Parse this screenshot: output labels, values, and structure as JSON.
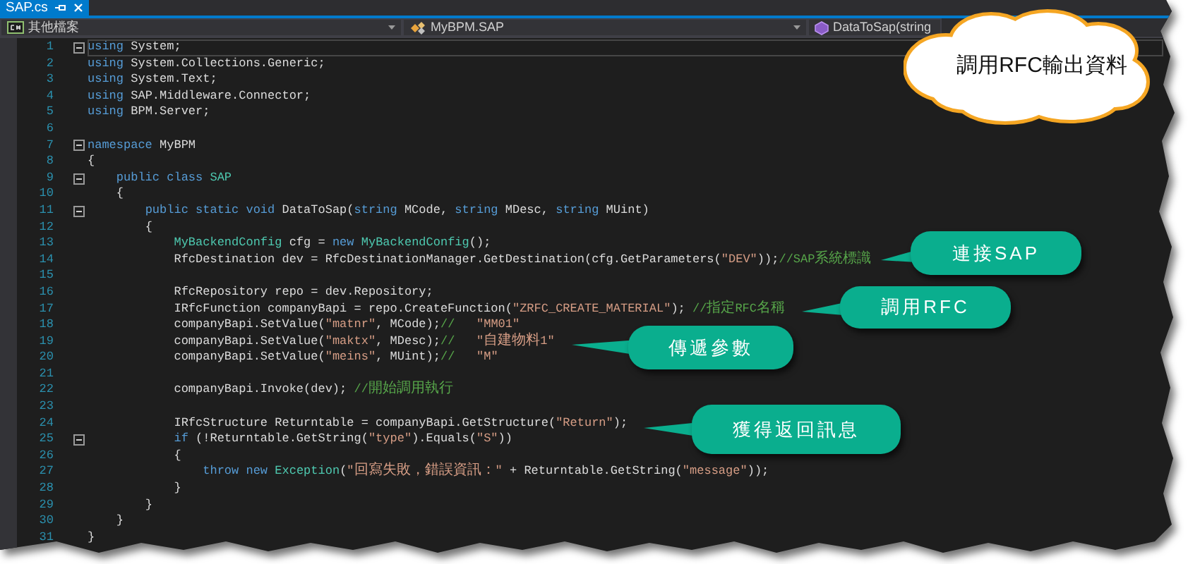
{
  "tab": {
    "label": "SAP.cs",
    "selected": true
  },
  "navigation": [
    {
      "kind": "file",
      "label": "其他檔案"
    },
    {
      "kind": "class",
      "label": "MyBPM.SAP"
    },
    {
      "kind": "method",
      "label": "DataToSap(string"
    }
  ],
  "code_lines": [
    {
      "number": "1",
      "fold": true,
      "current": true,
      "tokens": [
        {
          "kind": "keyword",
          "text": "using"
        },
        {
          "kind": "plain",
          "text": " System;"
        }
      ]
    },
    {
      "number": "2",
      "fold": false,
      "current": false,
      "tokens": [
        {
          "kind": "keyword",
          "text": "using"
        },
        {
          "kind": "plain",
          "text": " System.Collections.Generic;"
        }
      ]
    },
    {
      "number": "3",
      "fold": false,
      "current": false,
      "tokens": [
        {
          "kind": "keyword",
          "text": "using"
        },
        {
          "kind": "plain",
          "text": " System.Text;"
        }
      ]
    },
    {
      "number": "4",
      "fold": false,
      "current": false,
      "tokens": [
        {
          "kind": "keyword",
          "text": "using"
        },
        {
          "kind": "plain",
          "text": " SAP.Middleware.Connector;"
        }
      ]
    },
    {
      "number": "5",
      "fold": false,
      "current": false,
      "tokens": [
        {
          "kind": "keyword",
          "text": "using"
        },
        {
          "kind": "plain",
          "text": " BPM.Server;"
        }
      ]
    },
    {
      "number": "6",
      "fold": false,
      "current": false
    },
    {
      "number": "7",
      "fold": true,
      "current": false,
      "tokens": [
        {
          "kind": "keyword",
          "text": "namespace"
        },
        {
          "kind": "plain",
          "text": " MyBPM"
        }
      ]
    },
    {
      "number": "8",
      "fold": false,
      "current": false,
      "tokens": [
        {
          "kind": "plain",
          "text": "{"
        }
      ]
    },
    {
      "number": "9",
      "fold": true,
      "current": false,
      "tokens": [
        {
          "kind": "keyword",
          "text": "    public class"
        },
        {
          "kind": "type",
          "text": " SAP"
        }
      ]
    },
    {
      "number": "10",
      "fold": false,
      "current": false,
      "tokens": [
        {
          "kind": "plain",
          "text": "    {"
        }
      ]
    },
    {
      "number": "11",
      "fold": true,
      "current": false,
      "tokens": [
        {
          "kind": "keyword",
          "text": "        public static void"
        },
        {
          "kind": "plain",
          "text": " DataToSap("
        },
        {
          "kind": "keyword",
          "text": "string"
        },
        {
          "kind": "plain",
          "text": " MCode, "
        },
        {
          "kind": "keyword",
          "text": "string"
        },
        {
          "kind": "plain",
          "text": " MDesc, "
        },
        {
          "kind": "keyword",
          "text": "string"
        },
        {
          "kind": "plain",
          "text": " MUint)"
        }
      ]
    },
    {
      "number": "12",
      "fold": false,
      "current": false,
      "tokens": [
        {
          "kind": "plain",
          "text": "        {"
        }
      ]
    },
    {
      "number": "13",
      "fold": false,
      "current": false,
      "tokens": [
        {
          "kind": "type",
          "text": "            MyBackendConfig"
        },
        {
          "kind": "plain",
          "text": " cfg = "
        },
        {
          "kind": "keyword",
          "text": "new"
        },
        {
          "kind": "type",
          "text": " MyBackendConfig"
        },
        {
          "kind": "plain",
          "text": "();"
        }
      ]
    },
    {
      "number": "14",
      "fold": false,
      "current": false,
      "tokens": [
        {
          "kind": "plain",
          "text": "            RfcDestination dev = RfcDestinationManager.GetDestination(cfg.GetParameters("
        },
        {
          "kind": "string",
          "text": "\"DEV\""
        },
        {
          "kind": "plain",
          "text": "));"
        },
        {
          "kind": "comment",
          "text": "//SAP系統標識"
        }
      ]
    },
    {
      "number": "15",
      "fold": false,
      "current": false
    },
    {
      "number": "16",
      "fold": false,
      "current": false,
      "tokens": [
        {
          "kind": "plain",
          "text": "            RfcRepository repo = dev.Repository;"
        }
      ]
    },
    {
      "number": "17",
      "fold": false,
      "current": false,
      "tokens": [
        {
          "kind": "plain",
          "text": "            IRfcFunction companyBapi = repo.CreateFunction("
        },
        {
          "kind": "string",
          "text": "\"ZRFC_CREATE_MATERIAL\""
        },
        {
          "kind": "plain",
          "text": "); "
        },
        {
          "kind": "comment",
          "text": "//指定RFC名稱"
        }
      ]
    },
    {
      "number": "18",
      "fold": false,
      "current": false,
      "tokens": [
        {
          "kind": "plain",
          "text": "            companyBapi.SetValue("
        },
        {
          "kind": "string",
          "text": "\"matnr\""
        },
        {
          "kind": "plain",
          "text": ", MCode);"
        },
        {
          "kind": "comment",
          "text": "//"
        },
        {
          "kind": "string",
          "text": "   \"MM01\""
        }
      ]
    },
    {
      "number": "19",
      "fold": false,
      "current": false,
      "tokens": [
        {
          "kind": "plain",
          "text": "            companyBapi.SetValue("
        },
        {
          "kind": "string",
          "text": "\"maktx\""
        },
        {
          "kind": "plain",
          "text": ", MDesc);"
        },
        {
          "kind": "comment",
          "text": "//"
        },
        {
          "kind": "string",
          "text": "   \"自建物料1\""
        }
      ]
    },
    {
      "number": "20",
      "fold": false,
      "current": false,
      "tokens": [
        {
          "kind": "plain",
          "text": "            companyBapi.SetValue("
        },
        {
          "kind": "string",
          "text": "\"meins\""
        },
        {
          "kind": "plain",
          "text": ", MUint);"
        },
        {
          "kind": "comment",
          "text": "//"
        },
        {
          "kind": "string",
          "text": "   \"M\""
        }
      ]
    },
    {
      "number": "21",
      "fold": false,
      "current": false
    },
    {
      "number": "22",
      "fold": false,
      "current": false,
      "tokens": [
        {
          "kind": "plain",
          "text": "            companyBapi.Invoke(dev); "
        },
        {
          "kind": "comment",
          "text": "//開始調用執行"
        }
      ]
    },
    {
      "number": "23",
      "fold": false,
      "current": false
    },
    {
      "number": "24",
      "fold": false,
      "current": false,
      "tokens": [
        {
          "kind": "plain",
          "text": "            IRfcStructure Returntable = companyBapi.GetStructure("
        },
        {
          "kind": "string",
          "text": "\"Return\""
        },
        {
          "kind": "plain",
          "text": ");"
        }
      ]
    },
    {
      "number": "25",
      "fold": true,
      "current": false,
      "tokens": [
        {
          "kind": "keyword",
          "text": "            if"
        },
        {
          "kind": "plain",
          "text": " (!Returntable.GetString("
        },
        {
          "kind": "string",
          "text": "\"type\""
        },
        {
          "kind": "plain",
          "text": ").Equals("
        },
        {
          "kind": "string",
          "text": "\"S\""
        },
        {
          "kind": "plain",
          "text": "))"
        }
      ]
    },
    {
      "number": "26",
      "fold": false,
      "current": false,
      "tokens": [
        {
          "kind": "plain",
          "text": "            {"
        }
      ]
    },
    {
      "number": "27",
      "fold": false,
      "current": false,
      "tokens": [
        {
          "kind": "keyword",
          "text": "                throw new"
        },
        {
          "kind": "type",
          "text": " Exception"
        },
        {
          "kind": "plain",
          "text": "("
        },
        {
          "kind": "string",
          "text": "\"回寫失敗，錯誤資訊：\""
        },
        {
          "kind": "plain",
          "text": " + Returntable.GetString("
        },
        {
          "kind": "string",
          "text": "\"message\""
        },
        {
          "kind": "plain",
          "text": "));"
        }
      ]
    },
    {
      "number": "28",
      "fold": false,
      "current": false,
      "tokens": [
        {
          "kind": "plain",
          "text": "            }"
        }
      ]
    },
    {
      "number": "29",
      "fold": false,
      "current": false,
      "tokens": [
        {
          "kind": "plain",
          "text": "        }"
        }
      ]
    },
    {
      "number": "30",
      "fold": false,
      "current": false,
      "tokens": [
        {
          "kind": "plain",
          "text": "    }"
        }
      ]
    },
    {
      "number": "31",
      "fold": false,
      "current": false,
      "tokens": [
        {
          "kind": "plain",
          "text": "}"
        }
      ]
    }
  ],
  "cloud_callout": {
    "text": "調用RFC輸出資料"
  },
  "callouts": [
    {
      "text": "連接SAP"
    },
    {
      "text": "調用RFC"
    },
    {
      "text": "傳遞參數"
    },
    {
      "text": "獲得返回訊息"
    }
  ]
}
